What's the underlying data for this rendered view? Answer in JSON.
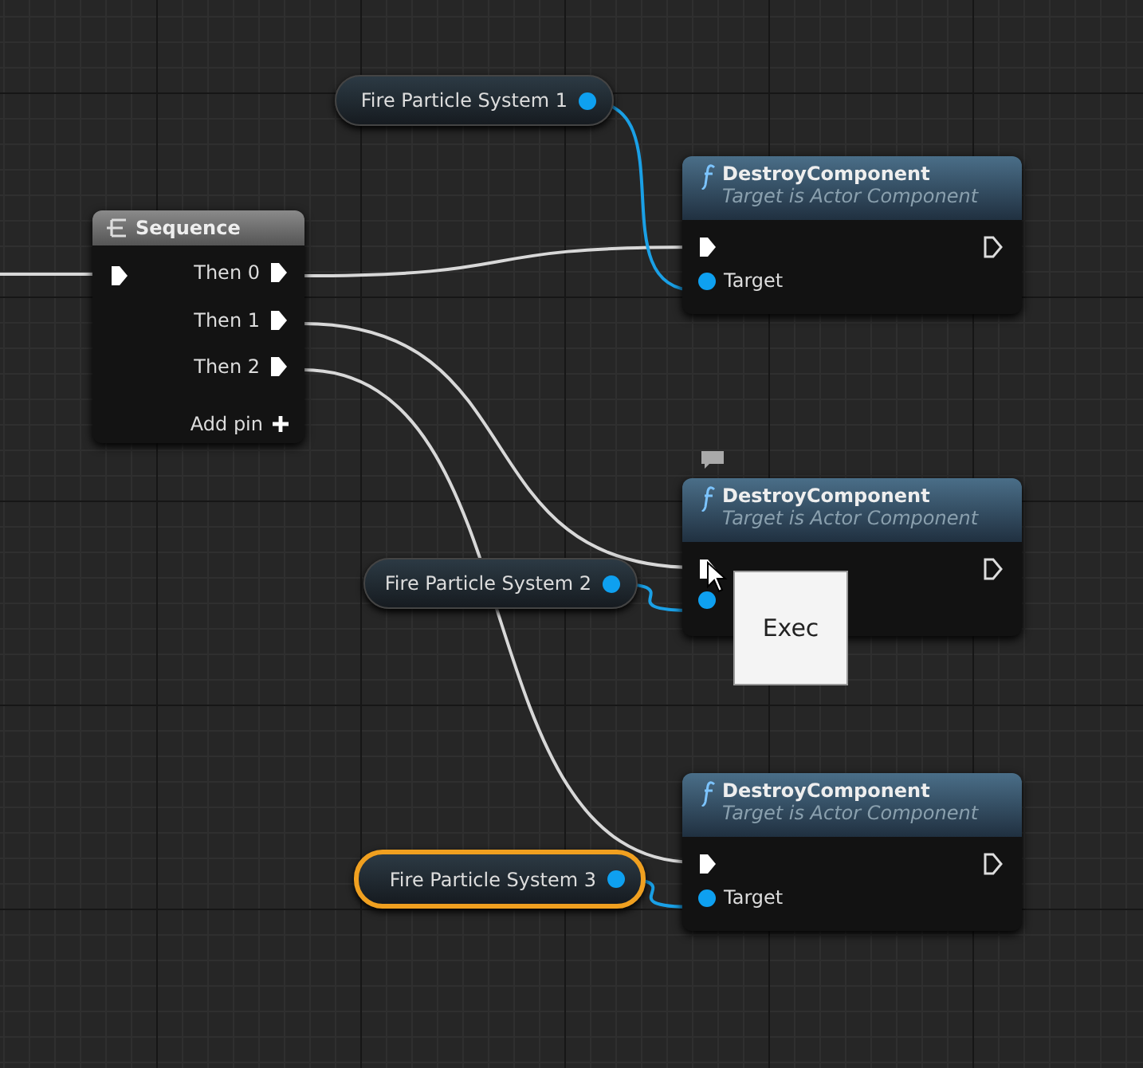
{
  "sequence": {
    "title": "Sequence",
    "outputs": [
      "Then 0",
      "Then 1",
      "Then 2"
    ],
    "add_pin": "Add pin"
  },
  "variables": [
    {
      "label": "Fire Particle System 1",
      "selected": false
    },
    {
      "label": "Fire Particle System 2",
      "selected": false
    },
    {
      "label": "Fire Particle System 3",
      "selected": true
    }
  ],
  "functions": [
    {
      "title": "DestroyComponent",
      "subtitle": "Target is Actor Component",
      "target_label": "Target",
      "comment_icon": false
    },
    {
      "title": "DestroyComponent",
      "subtitle": "Target is Actor Component",
      "comment_icon": true
    },
    {
      "title": "DestroyComponent",
      "subtitle": "Target is Actor Component",
      "target_label": "Target",
      "comment_icon": false
    }
  ],
  "tooltip": {
    "text": "Exec"
  }
}
